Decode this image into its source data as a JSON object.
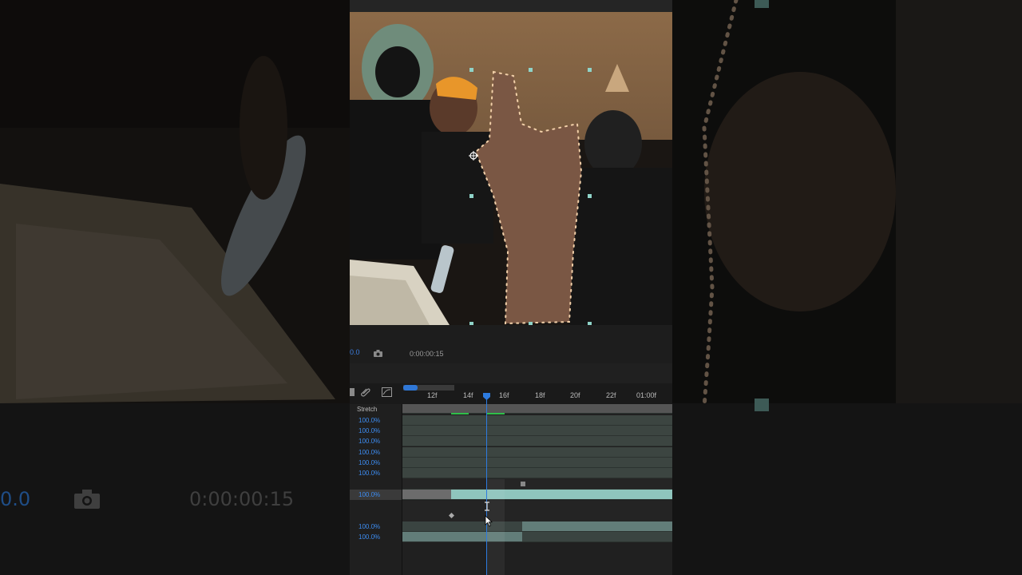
{
  "viewer": {
    "zoom_text": "0.0",
    "timecode": "0:00:00:15",
    "camera_icon": "camera-icon"
  },
  "background": {
    "zoom_text": "0.0",
    "timecode": "0:00:00:15"
  },
  "timeline": {
    "ruler_labels": [
      "12f",
      "14f",
      "16f",
      "18f",
      "20f",
      "22f",
      "01:00f"
    ],
    "column_header": "Stretch",
    "rows": [
      {
        "stretch": "100.0%"
      },
      {
        "stretch": "100.0%"
      },
      {
        "stretch": "100.0%"
      },
      {
        "stretch": "100.0%"
      },
      {
        "stretch": "100.0%"
      },
      {
        "stretch": "100.0%"
      },
      {
        "stretch": "100.0%"
      },
      {
        "stretch": "100.0%"
      },
      {
        "stretch": "100.0%"
      }
    ],
    "current_time_label": "16f"
  }
}
